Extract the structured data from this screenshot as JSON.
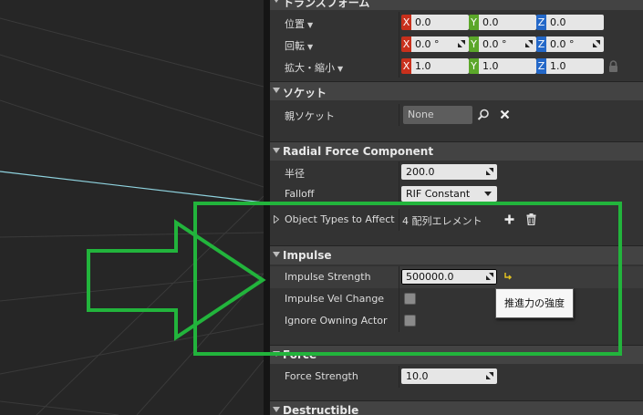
{
  "categories": {
    "transform": "トランスフォーム",
    "socket": "ソケット",
    "radial": "Radial Force Component",
    "impulse": "Impulse",
    "force": "Force",
    "destructible": "Destructible"
  },
  "transform": {
    "location": {
      "label": "位置",
      "x": "0.0",
      "y": "0.0",
      "z": "0.0"
    },
    "rotation": {
      "label": "回転",
      "x": "0.0 °",
      "y": "0.0 °",
      "z": "0.0 °"
    },
    "scale": {
      "label": "拡大・縮小",
      "x": "1.0",
      "y": "1.0",
      "z": "1.0"
    }
  },
  "axes": {
    "x": "X",
    "y": "Y",
    "z": "Z"
  },
  "socket": {
    "label": "親ソケット",
    "value": "None"
  },
  "radial": {
    "radius_label": "半径",
    "radius_value": "200.0",
    "falloff_label": "Falloff",
    "falloff_value": "RIF Constant",
    "object_types_label": "Object Types to Affect",
    "object_types_value": "4 配列エレメント"
  },
  "impulse": {
    "strength_label": "Impulse Strength",
    "strength_value": "500000.0",
    "vel_change_label": "Impulse Vel Change",
    "ignore_owning_label": "Ignore Owning Actor"
  },
  "tooltip": "推進力の強度",
  "force": {
    "strength_label": "Force Strength",
    "strength_value": "10.0"
  },
  "colors": {
    "annotation": "#22b43c",
    "axis_x": "#c8301c",
    "axis_y": "#5ba72a",
    "axis_z": "#2468c8",
    "reset_arrow": "#e0c020"
  }
}
